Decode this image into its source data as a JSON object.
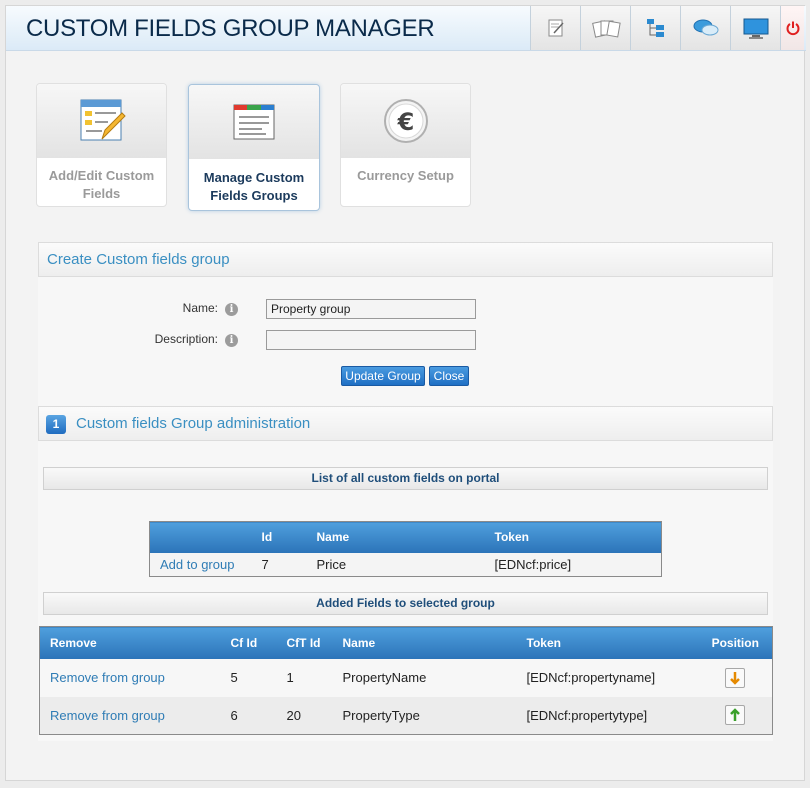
{
  "header": {
    "title": "CUSTOM FIELDS GROUP MANAGER"
  },
  "toolbar": [
    "notes-icon",
    "papers-icon",
    "tree-icon",
    "chat-icon",
    "monitor-icon",
    "power-icon"
  ],
  "tiles": [
    {
      "label": "Add/Edit Custom Fields",
      "icon": "form-edit-icon"
    },
    {
      "label": "Manage Custom Fields Groups",
      "icon": "window-icon"
    },
    {
      "label": "Currency Setup",
      "icon": "euro-icon"
    }
  ],
  "create_section": {
    "title": "Create Custom fields group",
    "name_label": "Name:",
    "name_value": "Property group",
    "description_label": "Description:",
    "description_value": "",
    "update_button": "Update Group",
    "close_button": "Close"
  },
  "admin_section": {
    "badge": "1",
    "title": "Custom fields Group administration",
    "list_strip": "List of all custom fields on portal",
    "added_strip": "Added Fields to selected group"
  },
  "portal_fields": {
    "headers": [
      "",
      "Id",
      "Name",
      "Token"
    ],
    "rows": [
      {
        "action": "Add to group",
        "id": "7",
        "name": "Price",
        "token": "[EDNcf:price]"
      }
    ]
  },
  "group_fields": {
    "headers": [
      "Remove",
      "Cf Id",
      "CfT Id",
      "Name",
      "Token",
      "Position"
    ],
    "rows": [
      {
        "action": "Remove from group",
        "cf_id": "5",
        "cft_id": "1",
        "name": "PropertyName",
        "token": "[EDNcf:propertyname]",
        "position": "down-arrow-icon"
      },
      {
        "action": "Remove from group",
        "cf_id": "6",
        "cft_id": "20",
        "name": "PropertyType",
        "token": "[EDNcf:propertytype]",
        "position": "up-arrow-icon"
      }
    ]
  },
  "colors": {
    "accent": "#3a8fc2",
    "header_blue": "#2b73b8",
    "button_blue": "#1f6fc4",
    "title_dark": "#0a2a4a",
    "power_red": "#e02020"
  }
}
